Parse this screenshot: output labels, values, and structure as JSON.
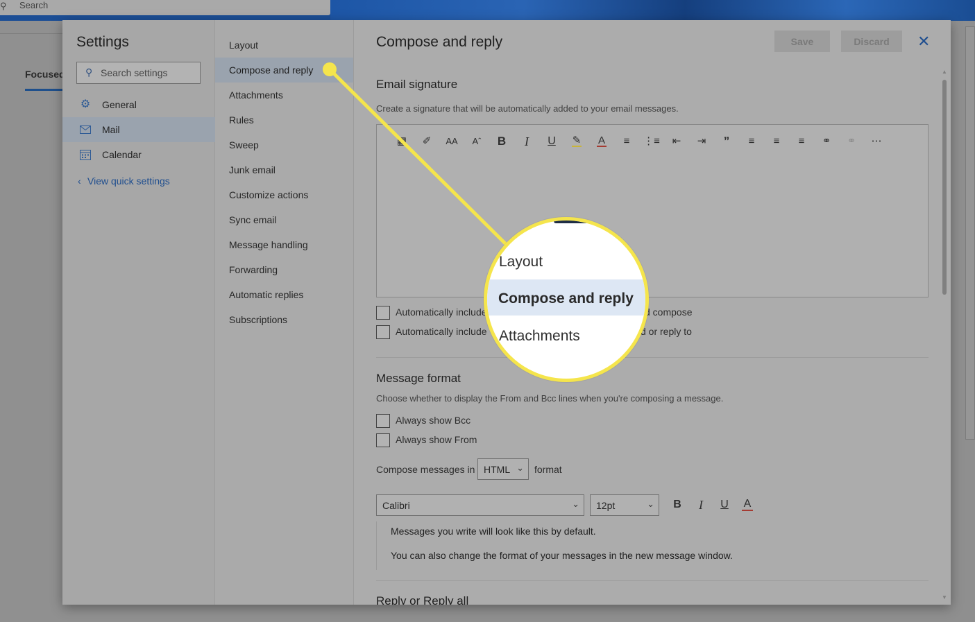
{
  "background": {
    "search_label": "Search",
    "focused_tab": "Focused"
  },
  "settings": {
    "title": "Settings",
    "search_placeholder": "Search settings",
    "categories": [
      {
        "label": "General",
        "icon": "gear-icon"
      },
      {
        "label": "Mail",
        "icon": "mail-icon"
      },
      {
        "label": "Calendar",
        "icon": "calendar-icon"
      }
    ],
    "quick_settings_link": "View quick settings"
  },
  "mail_nav": {
    "items": [
      "Layout",
      "Compose and reply",
      "Attachments",
      "Rules",
      "Sweep",
      "Junk email",
      "Customize actions",
      "Sync email",
      "Message handling",
      "Forwarding",
      "Automatic replies",
      "Subscriptions"
    ],
    "selected": "Compose and reply"
  },
  "content": {
    "heading": "Compose and reply",
    "save_label": "Save",
    "discard_label": "Discard",
    "signature": {
      "title": "Email signature",
      "description": "Create a signature that will be automatically added to your email messages.",
      "toolbar_icons": [
        "insert-image-icon",
        "format-painter-icon",
        "font-icon",
        "font-size-icon",
        "bold-icon",
        "italic-icon",
        "underline-icon",
        "highlight-icon",
        "font-color-icon",
        "bullets-icon",
        "numbering-icon",
        "decrease-indent-icon",
        "increase-indent-icon",
        "quote-icon",
        "align-left-icon",
        "align-center-icon",
        "align-right-icon",
        "link-icon",
        "remove-link-icon",
        "more-icon"
      ],
      "checkbox1_start": "Automatically include",
      "checkbox1_end": "d compose",
      "checkbox2_start": "Automatically include",
      "checkbox2_end": "d or reply to"
    },
    "message_format": {
      "title": "Message format",
      "description": "Choose whether to display the From and Bcc lines when you're composing a message.",
      "show_bcc": "Always show Bcc",
      "show_from": "Always show From",
      "compose_prefix": "Compose messages in",
      "compose_format": "HTML",
      "compose_suffix": "format",
      "font": "Calibri",
      "font_size": "12pt",
      "preview_line1": "Messages you write will look like this by default.",
      "preview_line2": "You can also change the format of your messages in the new message window."
    },
    "reply_title": "Reply or Reply all"
  },
  "callout": {
    "item_above": "Layout",
    "item_highlighted": "Compose and reply",
    "item_below": "Attachments",
    "accent": "#f5e54c"
  }
}
